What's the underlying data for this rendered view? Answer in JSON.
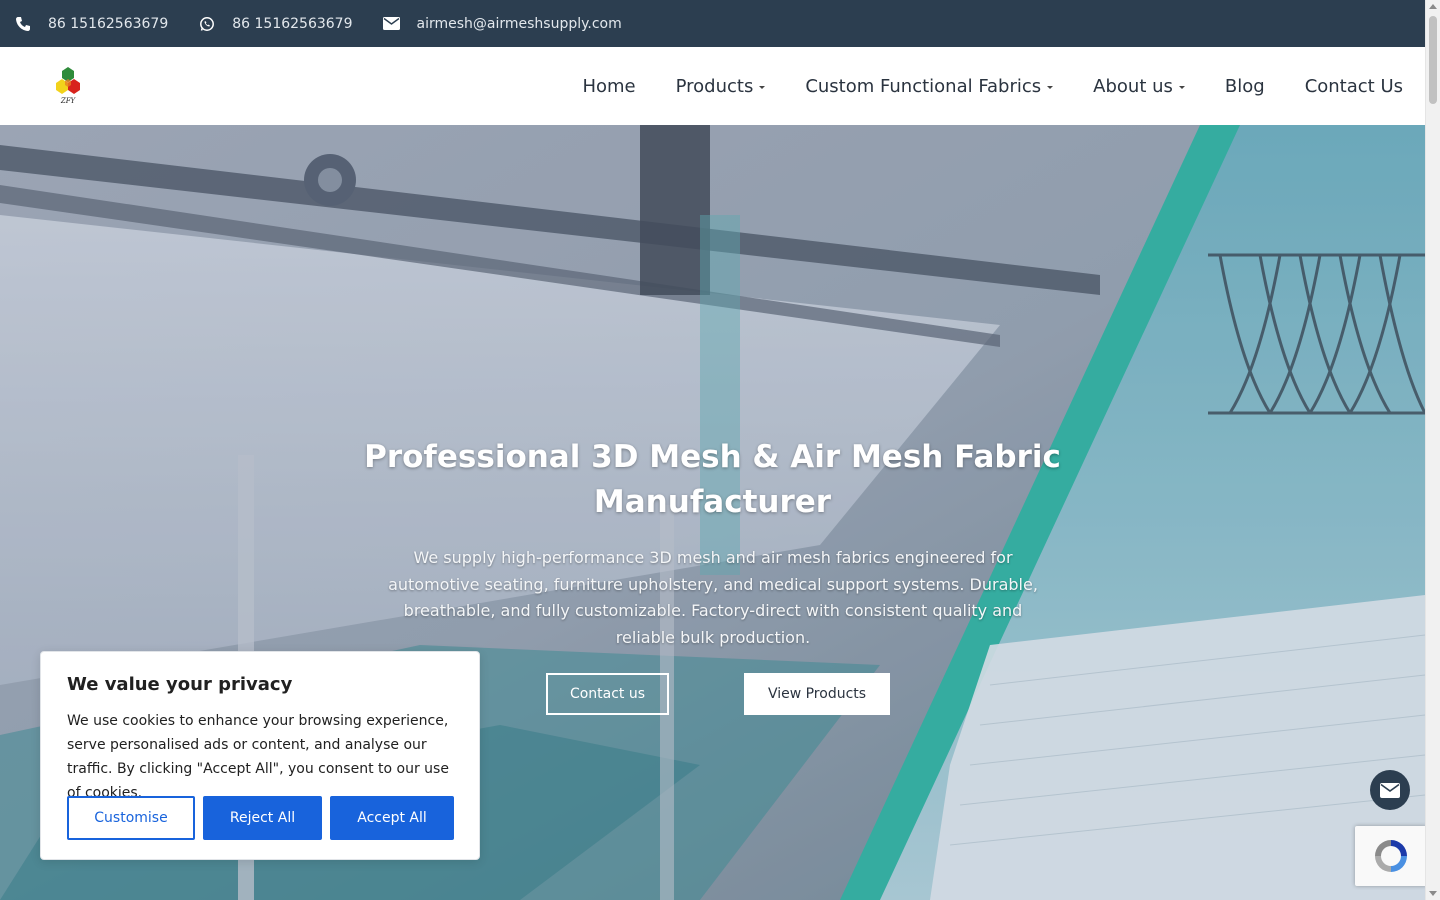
{
  "topbar": {
    "phone": "86 15162563679",
    "whatsapp": "86 15162563679",
    "email": "airmesh@airmeshsupply.com"
  },
  "logo": {
    "text": "ZFY"
  },
  "nav": {
    "items": [
      {
        "label": "Home",
        "has_dropdown": false
      },
      {
        "label": "Products",
        "has_dropdown": true
      },
      {
        "label": "Custom Functional Fabrics",
        "has_dropdown": true
      },
      {
        "label": "About us",
        "has_dropdown": true
      },
      {
        "label": "Blog",
        "has_dropdown": false
      },
      {
        "label": "Contact Us",
        "has_dropdown": false
      }
    ]
  },
  "hero": {
    "title_line1": "Professional 3D Mesh & Air Mesh Fabric",
    "title_line2": "Manufacturer",
    "subtitle": "We supply high-performance 3D mesh and air mesh fabrics engineered for automotive seating, furniture upholstery, and medical support systems. Durable, breathable, and fully customizable. Factory-direct with consistent quality and reliable bulk production.",
    "btn_contact": "Contact us",
    "btn_products": "View Products"
  },
  "cookie": {
    "title": "We value your privacy",
    "body": "We use cookies to enhance your browsing experience, serve personalised ads or content, and analyse our traffic. By clicking \"Accept All\", you consent to our use of cookies.",
    "customise": "Customise",
    "reject": "Reject All",
    "accept": "Accept All"
  },
  "colors": {
    "topbar_bg": "#2c3e50",
    "primary_blue": "#1863dc",
    "teal_accent": "#2fb8a4"
  }
}
